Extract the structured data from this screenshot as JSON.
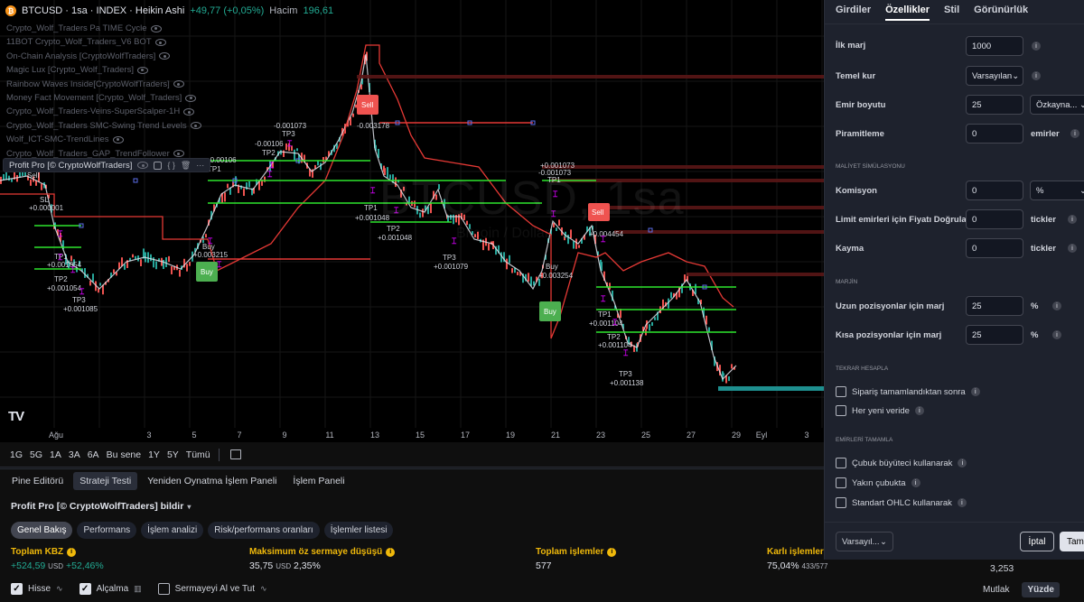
{
  "header": {
    "symbol": "BTCUSD · 1sa · INDEX · Heikin Ashi",
    "change": "+49,77 (+0,05%)",
    "volume_label": "Hacim",
    "volume_value": "196,61"
  },
  "indicators": [
    "Crypto_Wolf_Traders Pa TIME Cycle",
    "11BOT Crypto_Wolf_Traders_V6 BOT",
    "On-Chain Analysis [CryptoWolfTraders]",
    "Magic Lux [Crypto_Wolf_Traders]",
    "Rainbow Waves Inside[CryptoWolfTraders]",
    "Money Fact Movement [Crypto_Wolf_Traders]",
    "Crypto_Wolf_Traders-Veins-SuperScalper-1H",
    "Crypto_Wolf_Traders SMC-Swing Trend Levels",
    "Wolf_ICT-SMC-TrendLines",
    "Crypto_Wolf_Traders_GAP_TrendFollower"
  ],
  "profit_chip": "Profit Pro [© CryptoWolfTraders]",
  "watermark": "BTCUSD, 1sa",
  "watermark_sub": "Bitcoin / Dollar",
  "chart_labels": {
    "sell": "Sell",
    "buy": "Buy",
    "sl": "SL",
    "tp1": "TP1",
    "tp2": "TP2",
    "tp3": "TP3",
    "vals": [
      "+0.000001",
      "+0.001054",
      "+0.001054",
      "+0.001085",
      "+0.003215",
      "-0.00106",
      "+0.00106",
      "-0.001073",
      "-0.003178",
      "+0.001048",
      "+0.001048",
      "+0.001079",
      "+0.001073",
      "-0.001073",
      "+0.003254",
      "+0.004454",
      "+0.001104",
      "+0.001104",
      "+0.001138"
    ]
  },
  "xaxis": [
    "Ağu",
    "3",
    "5",
    "7",
    "9",
    "11",
    "13",
    "15",
    "17",
    "19",
    "21",
    "23",
    "25",
    "27",
    "29",
    "Eyl",
    "3"
  ],
  "timeframes": [
    "1G",
    "5G",
    "1A",
    "3A",
    "6A",
    "Bu sene",
    "1Y",
    "5Y",
    "Tümü"
  ],
  "tabs": [
    "Pine Editörü",
    "Strateji Testi",
    "Yeniden Oynatma İşlem Paneli",
    "İşlem Paneli"
  ],
  "strategy_title": "Profit Pro [© CryptoWolfTraders] bildir",
  "pills": [
    "Genel Bakış",
    "Performans",
    "İşlem analizi",
    "Risk/performans oranları",
    "İşlemler listesi"
  ],
  "stats": [
    {
      "label": "Toplam KBZ",
      "value": "+524,59",
      "unit": "USD",
      "extra": "+52,46%"
    },
    {
      "label": "Maksimum öz sermaye düşüşü",
      "value": "35,75",
      "unit": "USD",
      "extra": "2,35%"
    },
    {
      "label": "Toplam işlemler",
      "value": "577",
      "unit": "",
      "extra": ""
    },
    {
      "label": "Karlı işlemler",
      "value": "75,04%",
      "unit": "",
      "extra": "433/577"
    }
  ],
  "footer": {
    "hisse": "Hisse",
    "alcalma": "Alçalma",
    "buyhold": "Sermayeyi Al ve Tut"
  },
  "right_value": "3,253",
  "modes": [
    "Mutlak",
    "Yüzde"
  ],
  "panel": {
    "tabs": [
      "Girdiler",
      "Özellikler",
      "Stil",
      "Görünürlük"
    ],
    "ilk_marj_label": "İlk marj",
    "ilk_marj": "1000",
    "temel_kur_label": "Temel kur",
    "temel_kur": "Varsayılan",
    "emir_boyutu_label": "Emir boyutu",
    "emir_boyutu": "25",
    "emir_birimi": "Özkayna...",
    "piramitleme_label": "Piramitleme",
    "piramitleme": "0",
    "emirler": "emirler",
    "maliyet": "MALİYET SİMÜLASYONU",
    "komisyon_label": "Komisyon",
    "komisyon": "0",
    "komisyon_birim": "%",
    "limit_label": "Limit emirleri için Fiyatı Doğrula",
    "limit": "0",
    "tickler": "tickler",
    "kayma_label": "Kayma",
    "kayma": "0",
    "marjin": "MARJİN",
    "uzun_label": "Uzun pozisyonlar için marj",
    "uzun": "25",
    "kisa_label": "Kısa pozisyonlar için marj",
    "kisa": "25",
    "yuzde": "%",
    "tekrar": "TEKRAR HESAPLA",
    "siparis": "Sipariş tamamlandıktan sonra",
    "her_yeni": "Her yeni veride",
    "emirleri": "EMİRLERİ TAMAMLA",
    "cubuk": "Çubuk büyüteci kullanarak",
    "yakin": "Yakın çubukta",
    "standart": "Standart OHLC kullanarak",
    "varsayilan_btn": "Varsayıl...",
    "iptal": "İptal",
    "tamam": "Tam"
  }
}
